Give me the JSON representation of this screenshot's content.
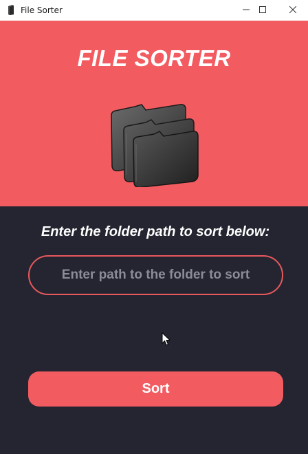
{
  "window": {
    "title": "File Sorter",
    "icons": {
      "app": "folder-icon",
      "minimize": "minimize-icon",
      "maximize": "maximize-icon",
      "close": "close-icon"
    }
  },
  "header": {
    "title": "FILE SORTER",
    "illustration": "folder-stack-icon"
  },
  "main": {
    "prompt": "Enter the folder path to sort below:",
    "path_input": {
      "value": "",
      "placeholder": "Enter path to the folder to sort"
    },
    "sort_button_label": "Sort"
  },
  "colors": {
    "accent": "#f25c60",
    "background_dark": "#242530",
    "placeholder": "#8a8c97",
    "text": "#ffffff"
  }
}
